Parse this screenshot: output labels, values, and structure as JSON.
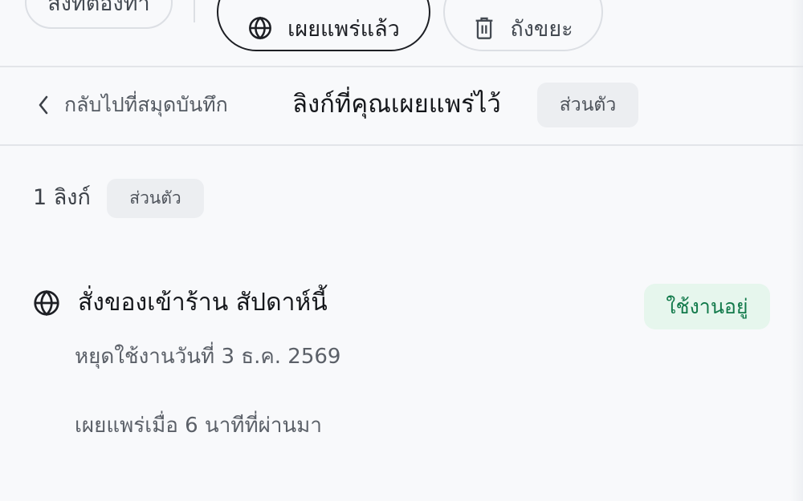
{
  "tabs": {
    "todo": {
      "label": "สิ่งที่ต้องทำ"
    },
    "published": {
      "label": "เผยแพร่แล้ว",
      "icon": "globe-icon"
    },
    "trash": {
      "label": "ถังขยะ",
      "icon": "trash-icon"
    }
  },
  "header": {
    "back_label": "กลับไปที่สมุดบันทึก",
    "title": "ลิงก์ที่คุณเผยแพร่ไว้",
    "badge": "ส่วนตัว"
  },
  "summary": {
    "count": "1 ลิงก์",
    "badge": "ส่วนตัว"
  },
  "items": [
    {
      "icon": "globe-icon",
      "title": "สั่งของเข้าร้าน สัปดาห์นี้",
      "status": "ใช้งานอยู่",
      "expires": "หยุดใช้งานวันที่ 3 ธ.ค. 2569",
      "published": "เผยแพร่เมื่อ 6 นาทีที่ผ่านมา"
    }
  ],
  "colors": {
    "accent_green": "#127a4b",
    "status_bg": "#e6f6ed",
    "text_primary": "#15171b",
    "badge_bg": "#eceef1"
  }
}
